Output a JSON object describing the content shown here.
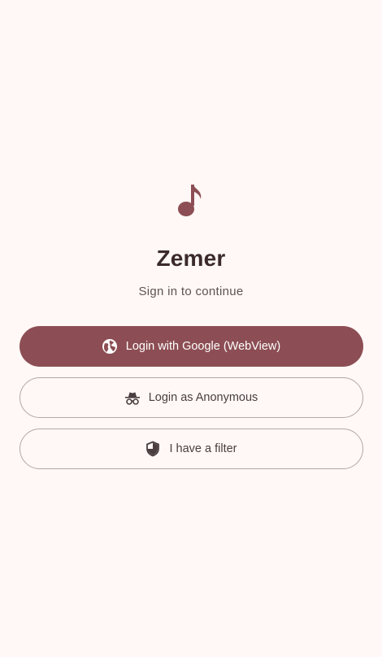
{
  "app": {
    "title": "Zemer",
    "subtitle": "Sign in to continue",
    "icon": "music-note-icon"
  },
  "buttons": {
    "google": {
      "label": "Login with Google (WebView)",
      "icon": "globe-icon"
    },
    "anonymous": {
      "label": "Login as Anonymous",
      "icon": "incognito-icon"
    },
    "filter": {
      "label": "I have a filter",
      "icon": "shield-icon"
    }
  },
  "colors": {
    "background": "#FFF8F6",
    "primary": "#8C4E54",
    "title": "#3B2A2C",
    "outline": "#B3A6A8"
  }
}
